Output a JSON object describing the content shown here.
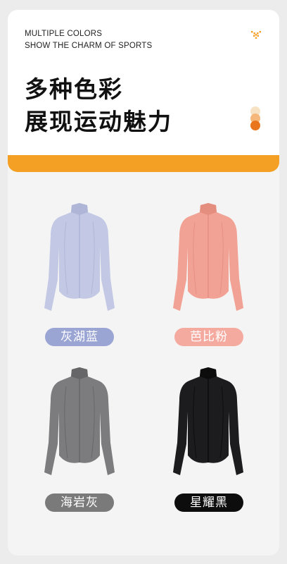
{
  "header": {
    "en_line1": "MULTIPLE COLORS",
    "en_line2": "SHOW THE CHARM OF SPORTS",
    "zh_line1": "多种色彩",
    "zh_line2": "展现运动魅力",
    "logo_icon": "orange-heart-logo-icon"
  },
  "accent_colors": {
    "orange": "#f4a024",
    "dot_light": "#f7e3c3",
    "dot_mid": "#f5b87a",
    "dot_dark": "#e9761c"
  },
  "products": [
    {
      "label": "灰湖蓝",
      "jacket_color": "#c3c9e4",
      "jacket_shade": "#aeb5d6",
      "badge_bg": "#9aa5d4",
      "badge_text": "#ffffff"
    },
    {
      "label": "芭比粉",
      "jacket_color": "#f2a294",
      "jacket_shade": "#e48e80",
      "badge_bg": "#f5aaa0",
      "badge_text": "#ffffff"
    },
    {
      "label": "海岩灰",
      "jacket_color": "#7c7c7e",
      "jacket_shade": "#666668",
      "badge_bg": "#7a7a7a",
      "badge_text": "#ffffff"
    },
    {
      "label": "星耀黑",
      "jacket_color": "#1c1c1e",
      "jacket_shade": "#0c0c0d",
      "badge_bg": "#0d0d0d",
      "badge_text": "#ffffff"
    }
  ]
}
